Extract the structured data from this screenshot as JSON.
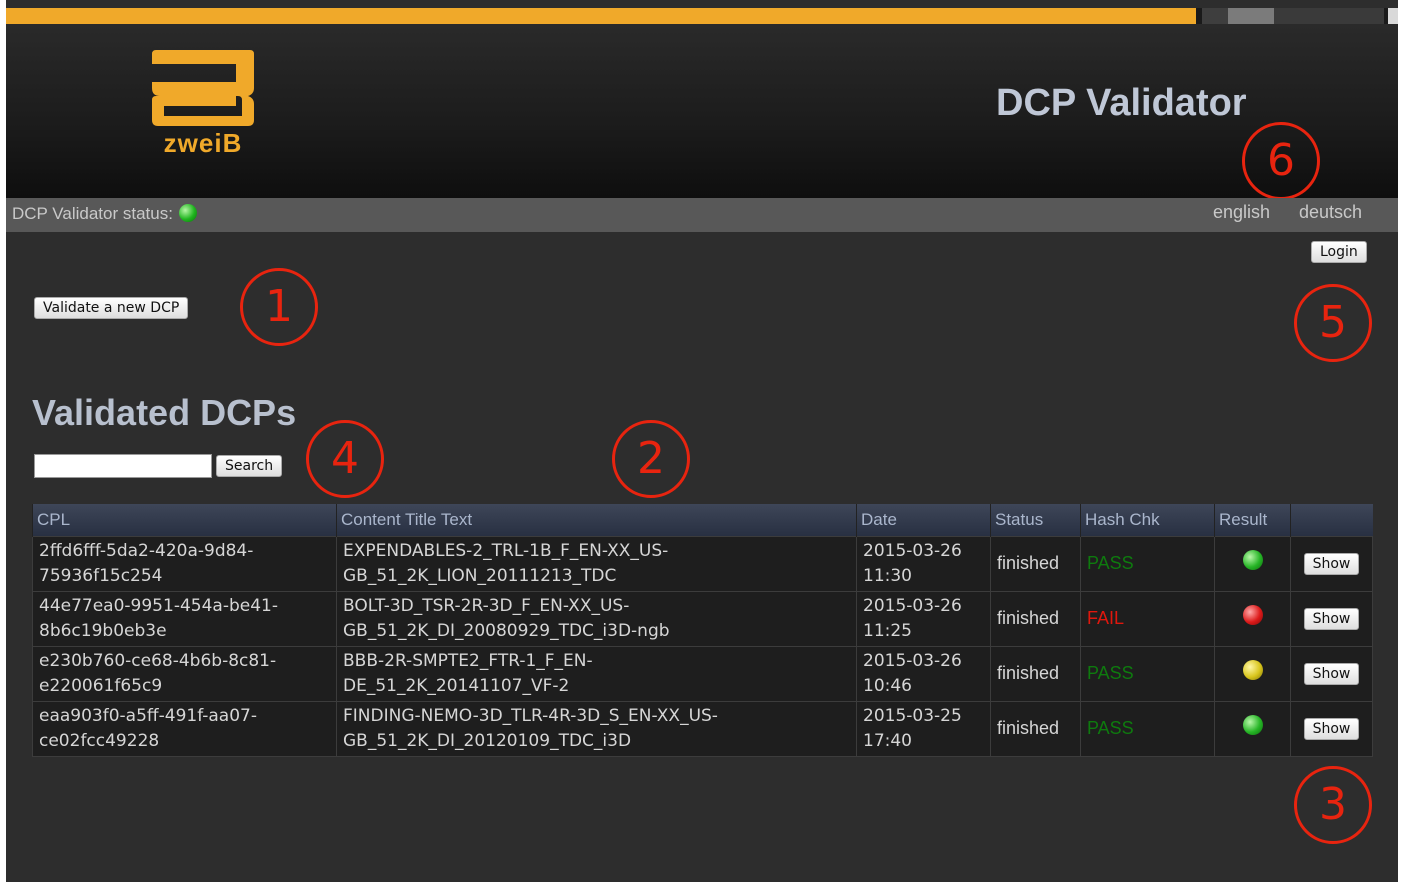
{
  "header": {
    "logo_text": "zweiB",
    "app_title": "DCP Validator"
  },
  "statusbar": {
    "label": "DCP Validator status:",
    "status_color": "#22b422",
    "languages": [
      "english",
      "deutsch"
    ]
  },
  "login_label": "Login",
  "validate_label": "Validate a new DCP",
  "page_title": "Validated DCPs",
  "search": {
    "value": "",
    "button": "Search"
  },
  "table": {
    "columns": [
      "CPL",
      "Content Title Text",
      "Date",
      "Status",
      "Hash Chk",
      "Result",
      ""
    ],
    "rows": [
      {
        "cpl": [
          "2ffd6fff-5da2-420a-9d84-",
          "75936f15c254"
        ],
        "title": [
          "EXPENDABLES-2_TRL-1B_F_EN-XX_US-",
          "GB_51_2K_LION_20111213_TDC"
        ],
        "date": [
          "2015-03-26",
          "11:30"
        ],
        "status": "finished",
        "hash": "PASS",
        "result": "green",
        "action": "Show"
      },
      {
        "cpl": [
          "44e77ea0-9951-454a-be41-",
          "8b6c19b0eb3e"
        ],
        "title": [
          "BOLT-3D_TSR-2R-3D_F_EN-XX_US-",
          "GB_51_2K_DI_20080929_TDC_i3D-ngb"
        ],
        "date": [
          "2015-03-26",
          "11:25"
        ],
        "status": "finished",
        "hash": "FAIL",
        "result": "red",
        "action": "Show"
      },
      {
        "cpl": [
          "e230b760-ce68-4b6b-8c81-",
          "e220061f65c9"
        ],
        "title": [
          "BBB-2R-SMPTE2_FTR-1_F_EN-",
          "DE_51_2K_20141107_VF-2"
        ],
        "date": [
          "2015-03-26",
          "10:46"
        ],
        "status": "finished",
        "hash": "PASS",
        "result": "yellow",
        "action": "Show"
      },
      {
        "cpl": [
          "eaa903f0-a5ff-491f-aa07-",
          "ce02fcc49228"
        ],
        "title": [
          "FINDING-NEMO-3D_TLR-4R-3D_S_EN-XX_US-",
          "GB_51_2K_DI_20120109_TDC_i3D"
        ],
        "date": [
          "2015-03-25",
          "17:40"
        ],
        "status": "finished",
        "hash": "PASS",
        "result": "green",
        "action": "Show"
      }
    ]
  },
  "callouts": [
    "1",
    "2",
    "3",
    "4",
    "5",
    "6"
  ],
  "colors": {
    "accent": "#f0a92a",
    "callout": "#e8240f",
    "pass": "#0e7a0e",
    "fail": "#e0170d"
  }
}
